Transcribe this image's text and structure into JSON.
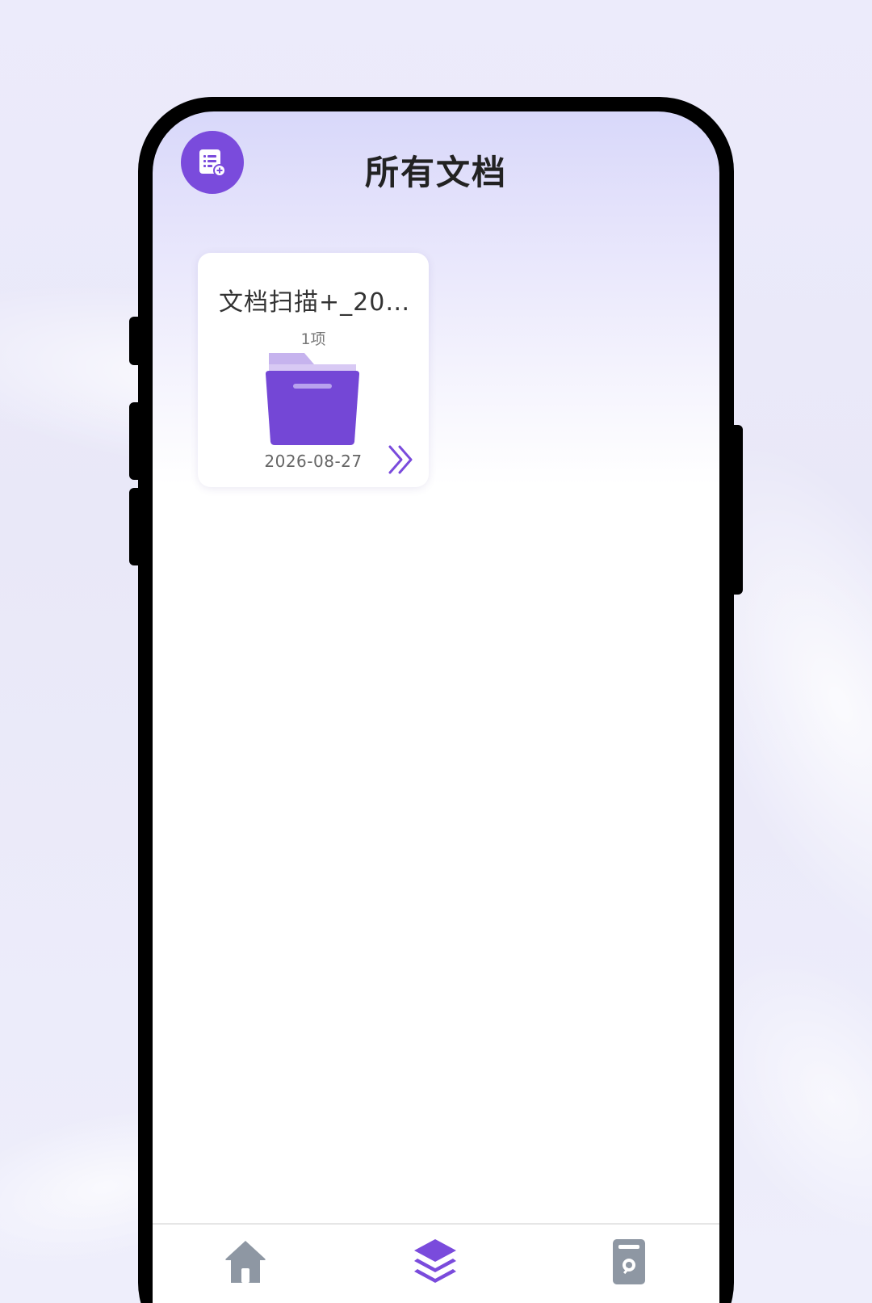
{
  "header": {
    "title": "所有文档",
    "icon": "document-list-add-icon"
  },
  "documents": [
    {
      "title": "文档扫描+_20…",
      "count": "1项",
      "date": "2026-08-27",
      "icon": "folder-icon",
      "open_icon": "double-chevron-right-icon"
    }
  ],
  "tabs": [
    {
      "icon": "home-icon",
      "active": false
    },
    {
      "icon": "layers-icon",
      "active": true
    },
    {
      "icon": "document-scan-icon",
      "active": false
    }
  ],
  "colors": {
    "accent": "#7a4bdc",
    "folder_light": "#c6b3ee",
    "folder_dark": "#7447d6",
    "inactive_tab": "#8e97a3"
  }
}
